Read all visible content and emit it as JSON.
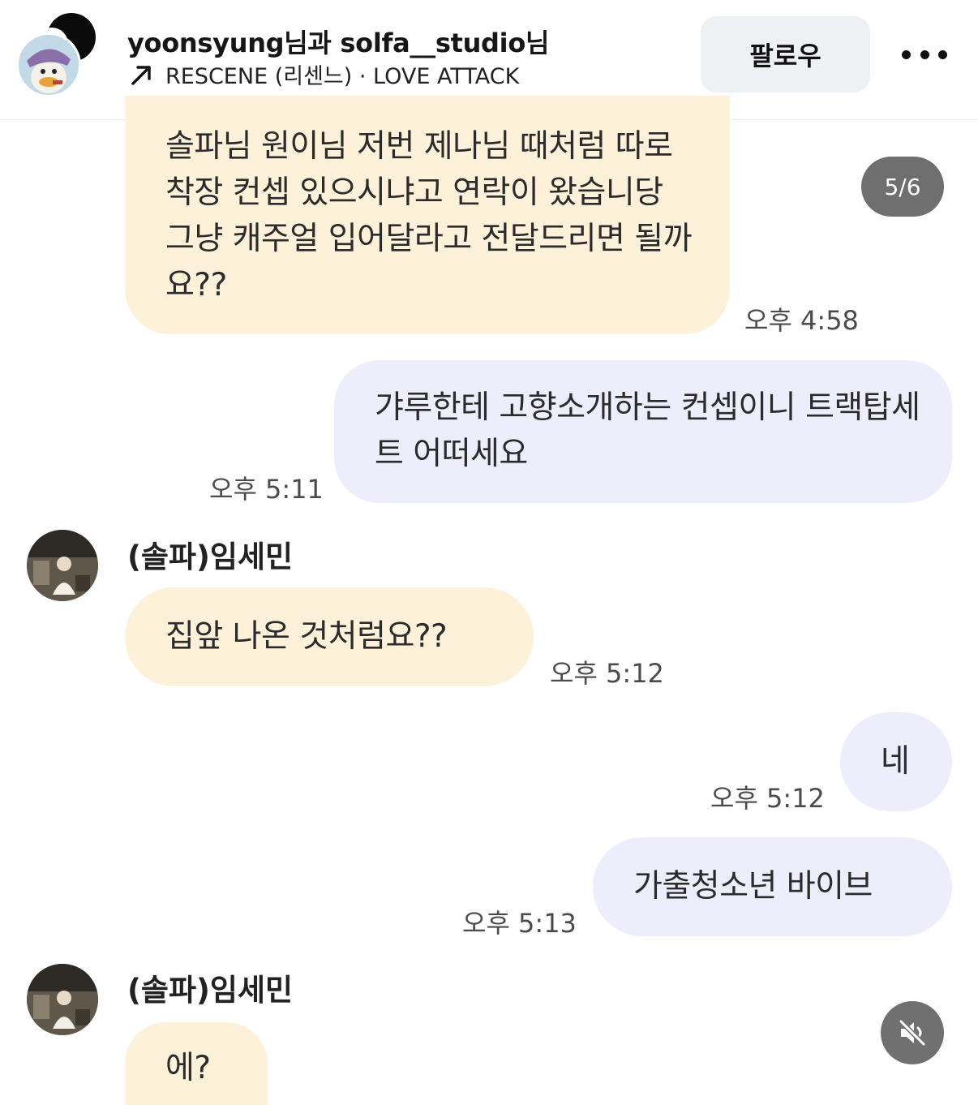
{
  "header": {
    "title": "yoonsyung님과 solfa__studio님",
    "music_icon": "arrow-up-right-icon",
    "music_text": "RESCENE (리센느) · LOVE ATTACK",
    "follow_label": "팔로우",
    "more_icon": "more-horizontal-icon"
  },
  "counter": "5/6",
  "messages": [
    {
      "direction": "incoming",
      "text": "솔파님 원이님 저번 제나님 때처럼 따로 착장 컨셉 있으시냐고 연락이 왔습니당 그냥 캐주얼 입어달라고 전달드리면 될까요??",
      "time": "오후 4:58"
    },
    {
      "direction": "outgoing",
      "text": "갸루한테 고향소개하는 컨셉이니 트랙탑세트 어떠세요",
      "time": "오후 5:11"
    },
    {
      "direction": "incoming",
      "sender": "(솔파)임세민",
      "text": "집앞 나온 것처럼요??",
      "time": "오후 5:12"
    },
    {
      "direction": "outgoing",
      "text": "네",
      "time": "오후 5:12"
    },
    {
      "direction": "outgoing",
      "text": "가출청소년 바이브",
      "time": "오후 5:13"
    },
    {
      "direction": "incoming",
      "sender": "(솔파)임세민",
      "text": "에?"
    }
  ],
  "mute_icon": "speaker-muted-icon",
  "colors": {
    "incoming_bubble": "#fdf1d9",
    "outgoing_bubble": "#eeedfb",
    "follow_button": "#eff0f3",
    "counter_badge": "#6f6f6f"
  }
}
